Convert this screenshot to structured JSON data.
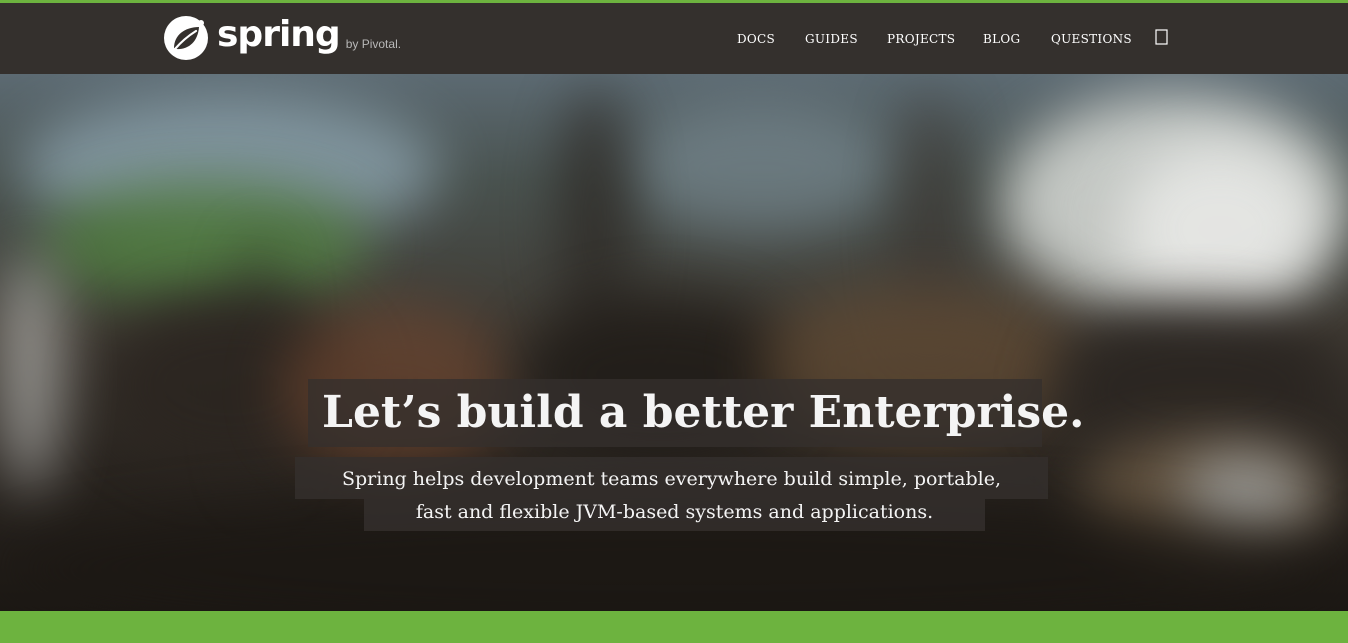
{
  "colors": {
    "brand_green": "#6db33f",
    "navbar_bg": "#34302d",
    "caption_bg": "rgba(52, 48, 45, 0.8)",
    "text_light": "#f4f4f4"
  },
  "header": {
    "logo_icon": "spring-leaf-icon",
    "wordmark": "spring",
    "byline": "by Pivotal.",
    "nav": [
      {
        "label": "DOCS"
      },
      {
        "label": "GUIDES"
      },
      {
        "label": "PROJECTS"
      },
      {
        "label": "BLOG"
      },
      {
        "label": "QUESTIONS"
      }
    ],
    "search_icon": "search-icon"
  },
  "hero": {
    "background": "blurred office photo",
    "headline": "Let’s build a better Enterprise.",
    "subline_1": "Spring helps development teams everywhere build simple, portable,",
    "subline_2": "fast and flexible JVM-based systems and applications."
  }
}
